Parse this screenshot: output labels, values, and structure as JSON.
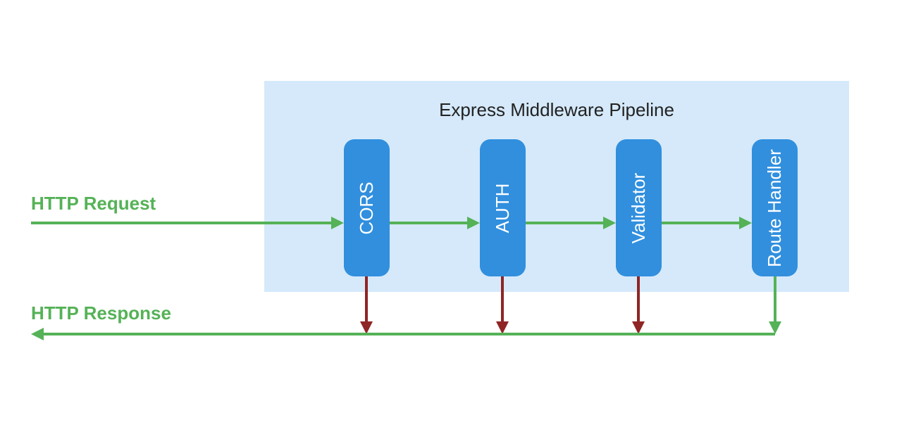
{
  "labels": {
    "request": "HTTP Request",
    "response": "HTTP Response",
    "pipeline_title": "Express Middleware Pipeline"
  },
  "middlewares": [
    {
      "name": "CORS",
      "early_exit": true
    },
    {
      "name": "AUTH",
      "early_exit": true
    },
    {
      "name": "Validator",
      "early_exit": true
    },
    {
      "name": "Route Handler",
      "early_exit": false
    }
  ],
  "colors": {
    "green": "#55b257",
    "red": "#8f2525",
    "blue": "#318fde",
    "panel": "#d5e9fa"
  }
}
